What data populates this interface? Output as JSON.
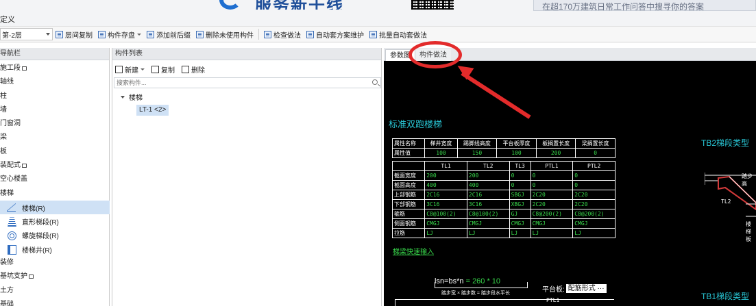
{
  "window": {
    "title": "定义",
    "ad_text": "在超170万建筑日常工作问答中搜寻你的答案"
  },
  "toolbar": {
    "floor": "第-2层",
    "buttons": [
      "层间复制",
      "构件存盘",
      "添加前后缀",
      "删除未使用构件",
      "检查做法",
      "自动套方案维护",
      "批量自动套做法"
    ]
  },
  "nav": {
    "title": "导航栏",
    "items": [
      "施工段",
      "轴线",
      "柱",
      "墙",
      "门窗洞",
      "梁",
      "板",
      "装配式",
      "空心楼盖",
      "楼梯"
    ],
    "sub_items": [
      "楼梯(R)",
      "直形梯段(R)",
      "螺旋梯段(R)",
      "楼梯井(R)"
    ],
    "tail_items": [
      "装修",
      "基坑支护",
      "土方",
      "基础"
    ]
  },
  "component_list": {
    "title": "构件列表",
    "new_label": "新建",
    "copy_label": "复制",
    "delete_label": "删除",
    "search_placeholder": "搜索构件...",
    "tree_root": "楼梯",
    "tree_leaf": "LT-1 <2>"
  },
  "right": {
    "tabs": [
      "参数图",
      "构件做法"
    ],
    "cad_title": "标准双跑楼梯",
    "tb2_title": "TB2梯段类型",
    "tb1_title": "TB1梯段类型",
    "link": "梯梁快速输入",
    "table1": {
      "headers": [
        "属性名称",
        "梯井宽度",
        "踢脚线高度",
        "平台板厚度",
        "板搁置长度",
        "梁搁置长度"
      ],
      "row_label": "属性值",
      "values": [
        "100",
        "150",
        "100",
        "200",
        "0"
      ]
    },
    "table2": {
      "headers": [
        "",
        "TL1",
        "TL2",
        "TL3",
        "PTL1",
        "PTL2"
      ],
      "rows": [
        {
          "label": "截面宽度",
          "values": [
            "200",
            "200",
            "0",
            "0",
            "0"
          ]
        },
        {
          "label": "截面高度",
          "values": [
            "400",
            "400",
            "0",
            "0",
            "0"
          ]
        },
        {
          "label": "上部钢筋",
          "values": [
            "2C16",
            "2C16",
            "SBGJ",
            "2C20",
            "2C20"
          ]
        },
        {
          "label": "下部钢筋",
          "values": [
            "3C16",
            "3C16",
            "XBGJ",
            "2C20",
            "2C20"
          ]
        },
        {
          "label": "箍筋",
          "values": [
            "C8@100(2)",
            "C8@100(2)",
            "GJ",
            "C8@200(2)",
            "C8@200(2)"
          ]
        },
        {
          "label": "侧面钢筋",
          "values": [
            "CMGJ",
            "CMGJ",
            "CMGJ",
            "CMGJ",
            "CMGJ"
          ]
        },
        {
          "label": "拉筋",
          "values": [
            "LJ",
            "LJ",
            "LJ",
            "LJ",
            "LJ"
          ]
        }
      ]
    },
    "formula_left": "lsn=bs*n",
    "formula_eq": "= ",
    "formula_value": "260 * 10",
    "formula_sub": "踏步宽 × 踏步数 = 踏步段水平长",
    "platform_label": "平台板:",
    "platform_value": "配筋形式 ···",
    "ptl_label": "PTL1",
    "tl_label": "TL2",
    "step_label": "踏步高",
    "step_label2": "楼梯板"
  }
}
